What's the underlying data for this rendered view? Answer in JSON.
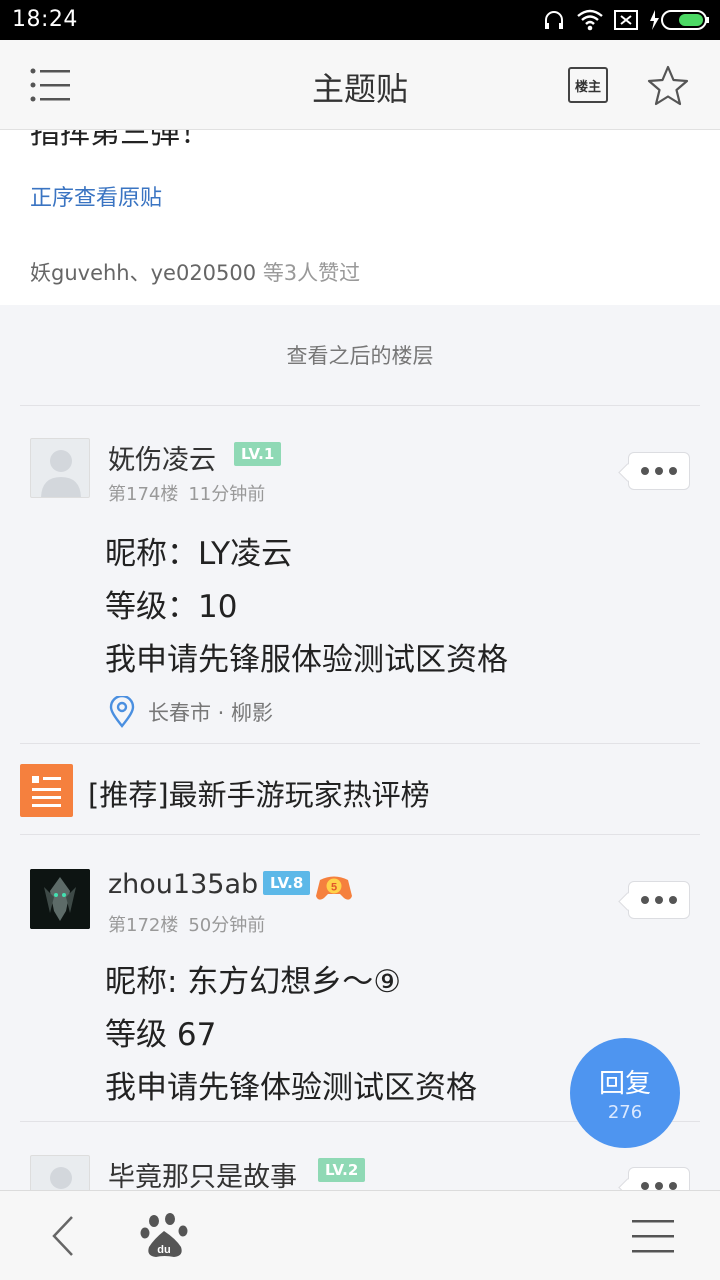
{
  "status_bar": {
    "time": "18:24"
  },
  "nav": {
    "title": "主题贴",
    "louzhu_label": "楼主"
  },
  "top_card": {
    "cut_text": "指挥第三弹！",
    "view_original": "正序查看原贴",
    "likers": "妖guvehh、ye020500",
    "likes_suffix": "等3人赞过"
  },
  "later_floors_label": "查看之后的楼层",
  "posts": [
    {
      "username": "妩伤凌云",
      "level": "LV.1",
      "floor": "第174楼",
      "time": "11分钟前",
      "lines": [
        "昵称：LY凌云",
        "等级：10",
        "我申请先锋服体验测试区资格"
      ],
      "location": "长春市 · 柳影"
    },
    {
      "username": "zhou135ab",
      "level": "LV.8",
      "badge": "5",
      "floor": "第172楼",
      "time": "50分钟前",
      "lines": [
        "昵称: 东方幻想乡～⑨",
        "等级 67",
        "我申请先锋体验测试区资格"
      ]
    },
    {
      "username": "毕竟那只是故事",
      "level": "LV.2"
    }
  ],
  "recommend": {
    "text": "[推荐]最新手游玩家热评榜"
  },
  "reply_fab": {
    "label": "回复",
    "count": "276"
  },
  "colors": {
    "link": "#3a74c2",
    "fab": "#4e95f0",
    "level_green": "#8fd9b5",
    "level_blue": "#5cb8e8",
    "recommend_orange": "#f5803e"
  }
}
